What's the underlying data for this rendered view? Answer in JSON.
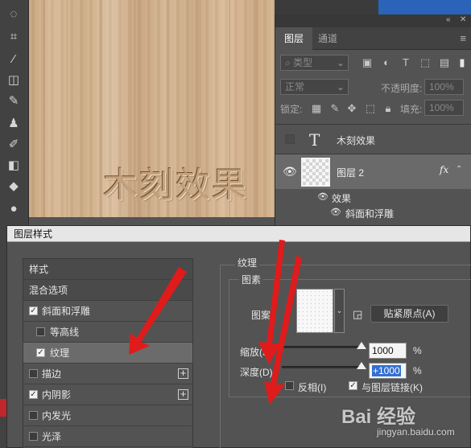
{
  "canvas": {
    "text": "木刻效果"
  },
  "layers_panel": {
    "tabs": [
      "图层",
      "通道"
    ],
    "kind_filter": "类型",
    "blend_mode": "正常",
    "opacity_label": "不透明度:",
    "opacity_value": "100%",
    "lock_label": "锁定:",
    "fill_label": "填充:",
    "fill_value": "100%",
    "layers": [
      {
        "type_icon": "T",
        "name": "木刻效果"
      },
      {
        "name": "图层 2",
        "fx": "fx"
      }
    ],
    "effects_label": "效果",
    "effect_items": [
      "斜面和浮雕"
    ]
  },
  "dialog": {
    "title": "图层样式",
    "styles": [
      {
        "label": "样式"
      },
      {
        "label": "混合选项"
      },
      {
        "label": "斜面和浮雕",
        "checked": true
      },
      {
        "label": "等高线",
        "checked": false
      },
      {
        "label": "纹理",
        "checked": true
      },
      {
        "label": "描边",
        "checked": false
      },
      {
        "label": "内阴影",
        "checked": true
      },
      {
        "label": "内发光",
        "checked": false
      },
      {
        "label": "光泽",
        "checked": false
      }
    ],
    "texture": {
      "section_title": "纹理",
      "group_title": "图素",
      "pattern_label": "图案:",
      "snap_button": "贴紧原点(A)",
      "scale_label": "缩放(S):",
      "scale_value": "1000",
      "depth_label": "深度(D):",
      "depth_value": "+1000",
      "percent": "%",
      "invert_label": "反相(I)",
      "invert_checked": false,
      "link_label": "与图层链接(K)",
      "link_checked": true
    }
  },
  "watermark": {
    "text": "Bai 经验",
    "url": "jingyan.baidu.com"
  },
  "colors": {
    "arrow": "#e01b1b",
    "selection": "#3370d4"
  }
}
